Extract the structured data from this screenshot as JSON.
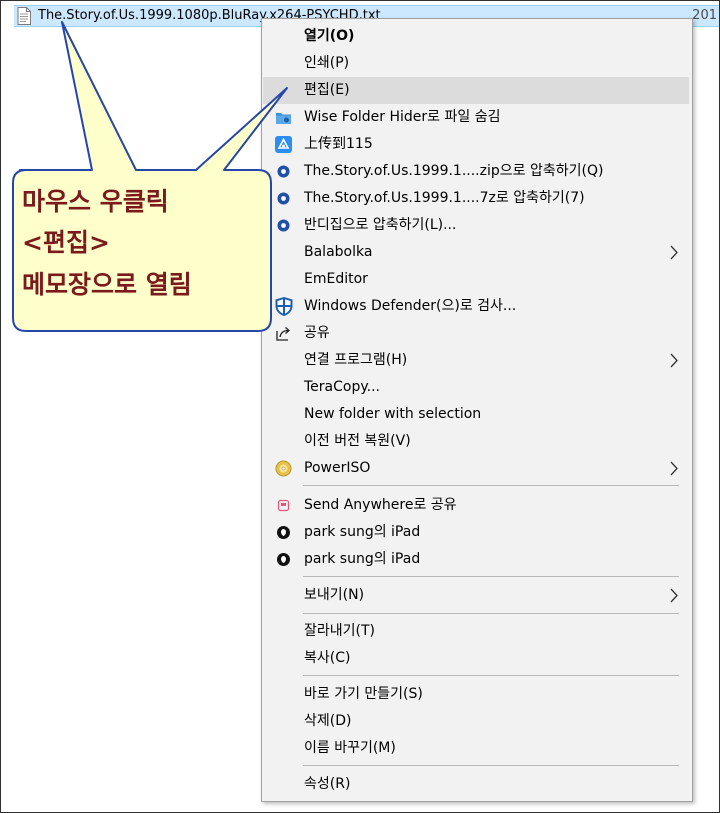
{
  "file": {
    "name": "The.Story.of.Us.1999.1080p.BluRay.x264-PSYCHD.txt",
    "date": "201"
  },
  "menu": {
    "items": [
      {
        "label": "열기(O)",
        "icon": "none",
        "bold": true
      },
      {
        "label": "인쇄(P)",
        "icon": "none"
      },
      {
        "label": "편집(E)",
        "icon": "none",
        "highlighted": true
      },
      {
        "label": "Wise Folder Hider로 파일 숨김",
        "icon": "folder-hider-icon"
      },
      {
        "label": "上传到115",
        "icon": "cloud-115-icon"
      },
      {
        "label": "The.Story.of.Us.1999.1....zip으로 압축하기(Q)",
        "icon": "bandizip-icon"
      },
      {
        "label": "The.Story.of.Us.1999.1....7z로 압축하기(7)",
        "icon": "bandizip-icon"
      },
      {
        "label": "반디집으로 압축하기(L)...",
        "icon": "bandizip-icon"
      },
      {
        "label": "Balabolka",
        "icon": "none",
        "submenu": true
      },
      {
        "label": "EmEditor",
        "icon": "none"
      },
      {
        "label": "Windows Defender(으)로 검사...",
        "icon": "defender-shield-icon"
      },
      {
        "label": "공유",
        "icon": "share-icon"
      },
      {
        "label": "연결 프로그램(H)",
        "icon": "none",
        "submenu": true
      },
      {
        "label": "TeraCopy...",
        "icon": "none"
      },
      {
        "label": "New folder with selection",
        "icon": "none"
      },
      {
        "label": "이전 버전 복원(V)",
        "icon": "none"
      },
      {
        "label": "PowerISO",
        "icon": "poweriso-disc-icon",
        "submenu": true
      },
      {
        "label": "Send Anywhere로 공유",
        "icon": "send-anywhere-icon"
      },
      {
        "label": "park sung의 iPad",
        "icon": "ipad-device-icon"
      },
      {
        "label": "park sung의 iPad",
        "icon": "ipad-device-icon"
      },
      {
        "label": "보내기(N)",
        "icon": "none",
        "submenu": true
      },
      {
        "label": "잘라내기(T)",
        "icon": "none"
      },
      {
        "label": "복사(C)",
        "icon": "none"
      },
      {
        "label": "바로 가기 만들기(S)",
        "icon": "none"
      },
      {
        "label": "삭제(D)",
        "icon": "none"
      },
      {
        "label": "이름 바꾸기(M)",
        "icon": "none"
      },
      {
        "label": "속성(R)",
        "icon": "none"
      }
    ]
  },
  "callout": {
    "lines": [
      "마우스 우클릭",
      "<편집>",
      "메모장으로 열림"
    ]
  },
  "colors": {
    "selection": "#cce8ff",
    "menu_bg": "#f2f2f2",
    "highlight": "#dcdcdc",
    "callout_fill": "#ffffcc",
    "callout_border": "#2646a8",
    "callout_text": "#7a1a1a"
  }
}
